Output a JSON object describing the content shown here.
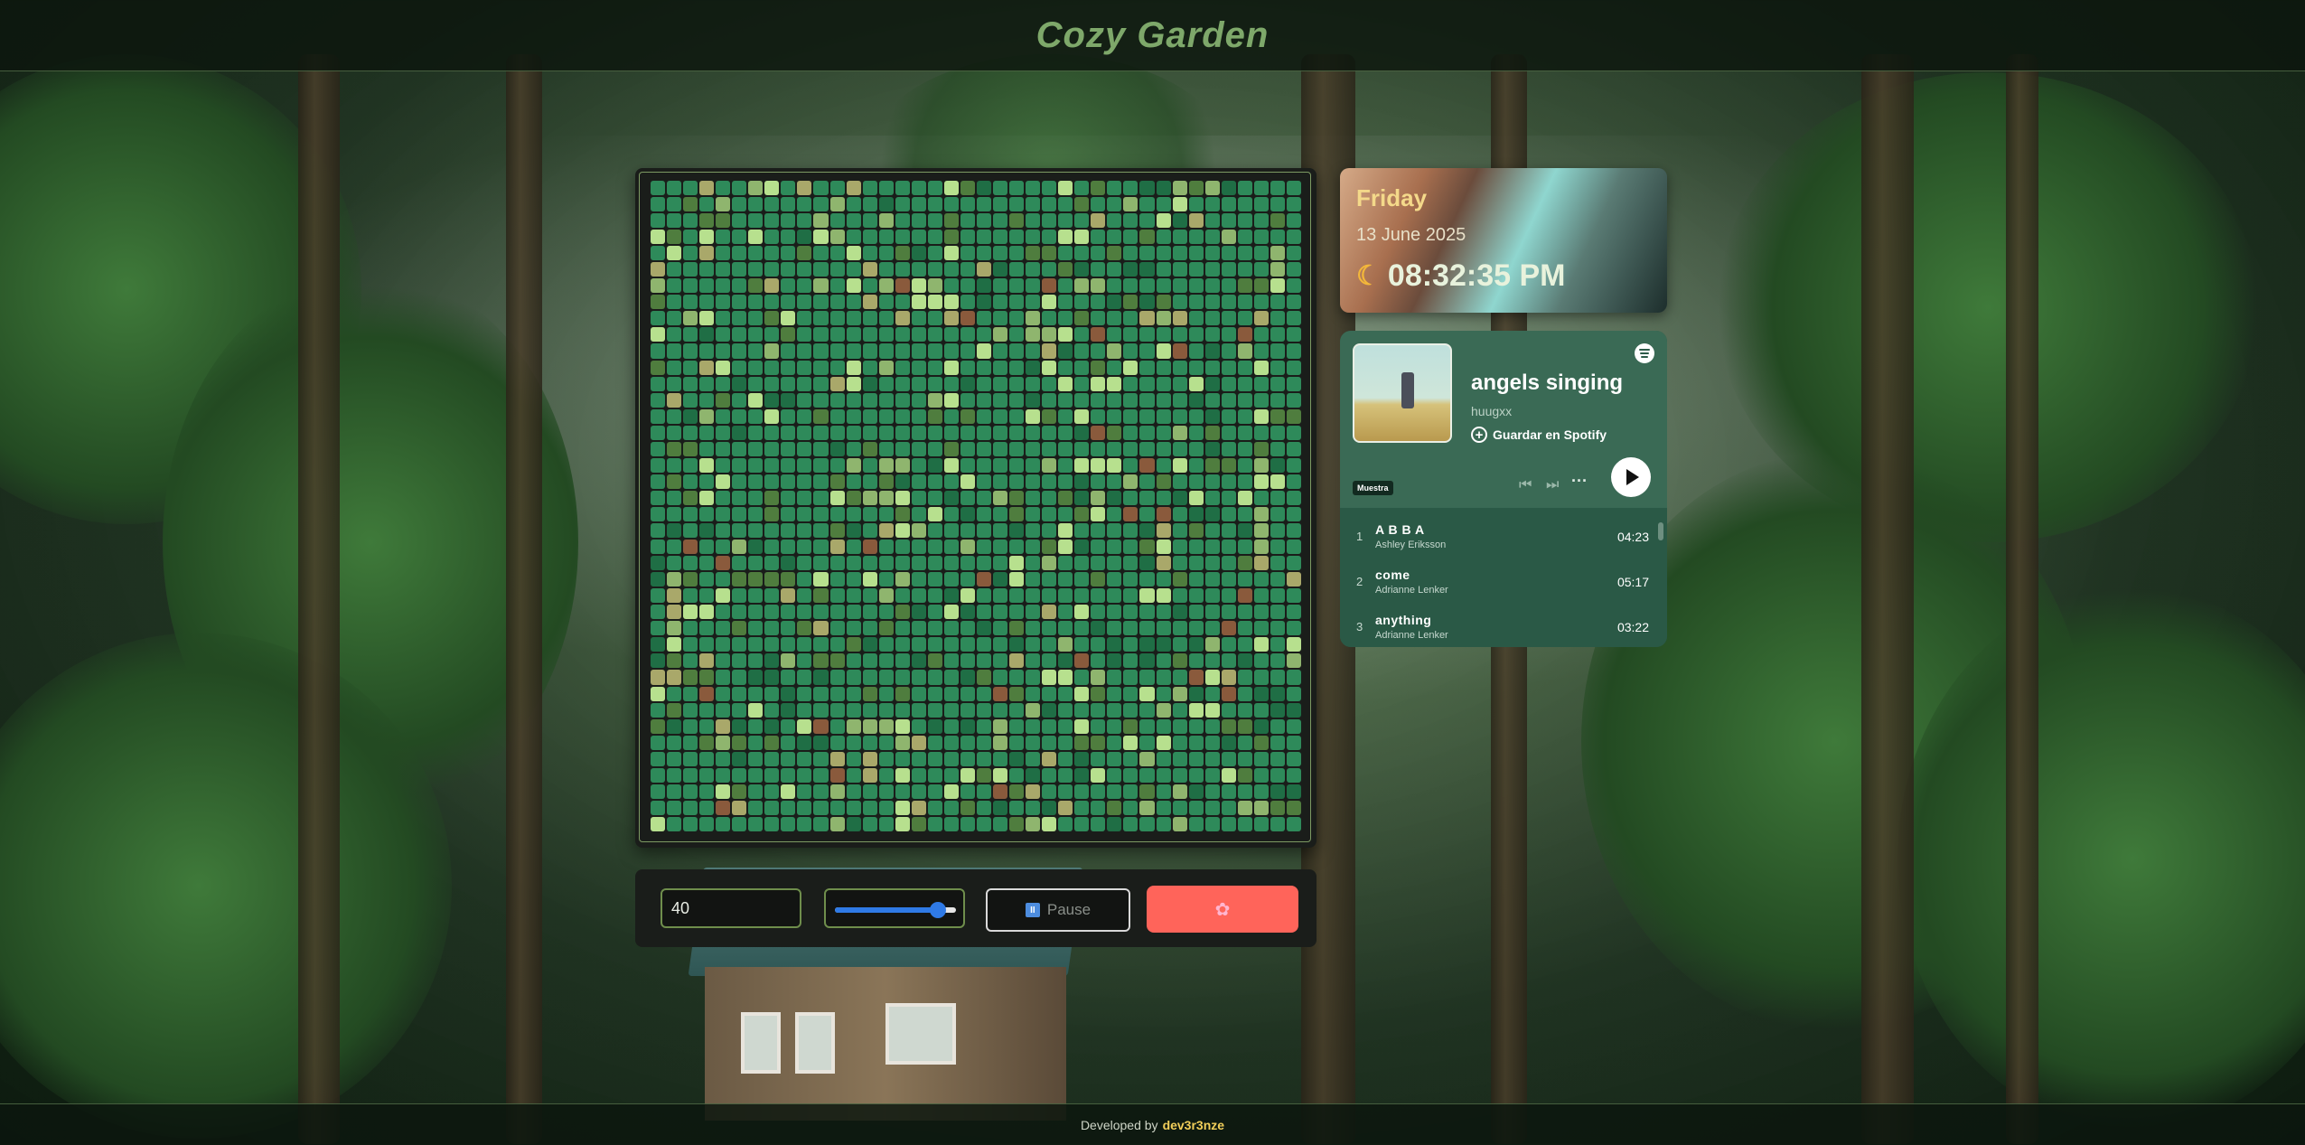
{
  "header": {
    "title": "Cozy Garden"
  },
  "garden": {
    "grid_size": 40,
    "palette": [
      "#2e8a5a",
      "#1f6e45",
      "#4f7d3e",
      "#8fb56e",
      "#b7e08e",
      "#8a5a3c",
      "#a9a86a"
    ]
  },
  "controls": {
    "grid_size_value": "40",
    "speed_fraction": 0.85,
    "pause_label": "Pause",
    "pause_icon": "pause-icon",
    "flower_icon": "flower-icon",
    "accent_color": "#ff645a"
  },
  "datetime": {
    "day": "Friday",
    "date": "13 June 2025",
    "time": "08:32:35 PM",
    "icon": "moon-icon"
  },
  "player": {
    "song_title": "angels singing",
    "artist": "huugxx",
    "save_label": "Guardar en Spotify",
    "preview_badge": "Muestra",
    "tracks": [
      {
        "num": "1",
        "title": "A B B A",
        "artist": "Ashley Eriksson",
        "duration": "04:23"
      },
      {
        "num": "2",
        "title": "come",
        "artist": "Adrianne Lenker",
        "duration": "05:17"
      },
      {
        "num": "3",
        "title": "anything",
        "artist": "Adrianne Lenker",
        "duration": "03:22"
      }
    ]
  },
  "footer": {
    "prefix": "Developed by",
    "author": "dev3r3nze"
  }
}
